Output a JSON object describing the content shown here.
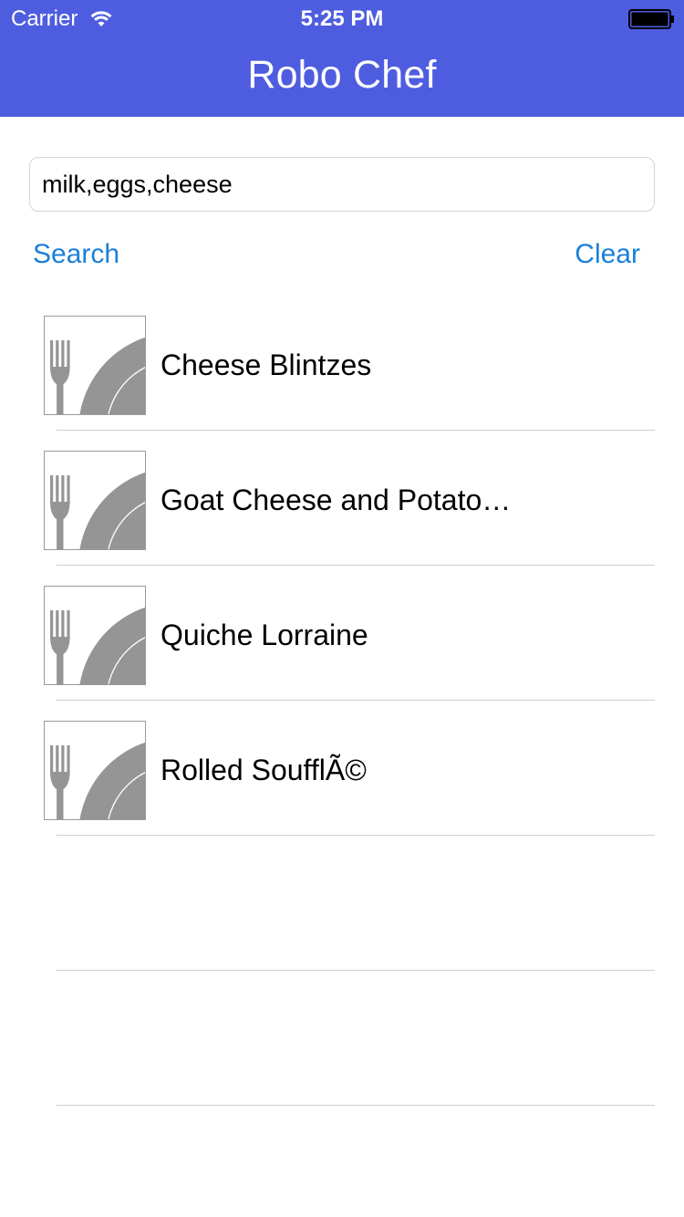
{
  "status_bar": {
    "carrier": "Carrier",
    "time": "5:25 PM",
    "wifi_icon": "wifi-icon",
    "battery_icon": "battery-icon"
  },
  "nav": {
    "title": "Robo Chef",
    "color": "#4e5de0"
  },
  "search": {
    "value": "milk,eggs,cheese",
    "search_label": "Search",
    "clear_label": "Clear",
    "accent": "#1a7fd8"
  },
  "recipes": [
    {
      "name": "Cheese Blintzes",
      "icon": "fork-plate-icon"
    },
    {
      "name": "Goat Cheese and Potato…",
      "icon": "fork-plate-icon"
    },
    {
      "name": "Quiche Lorraine",
      "icon": "fork-plate-icon"
    },
    {
      "name": "Rolled SoufflÃ©",
      "icon": "fork-plate-icon"
    }
  ]
}
